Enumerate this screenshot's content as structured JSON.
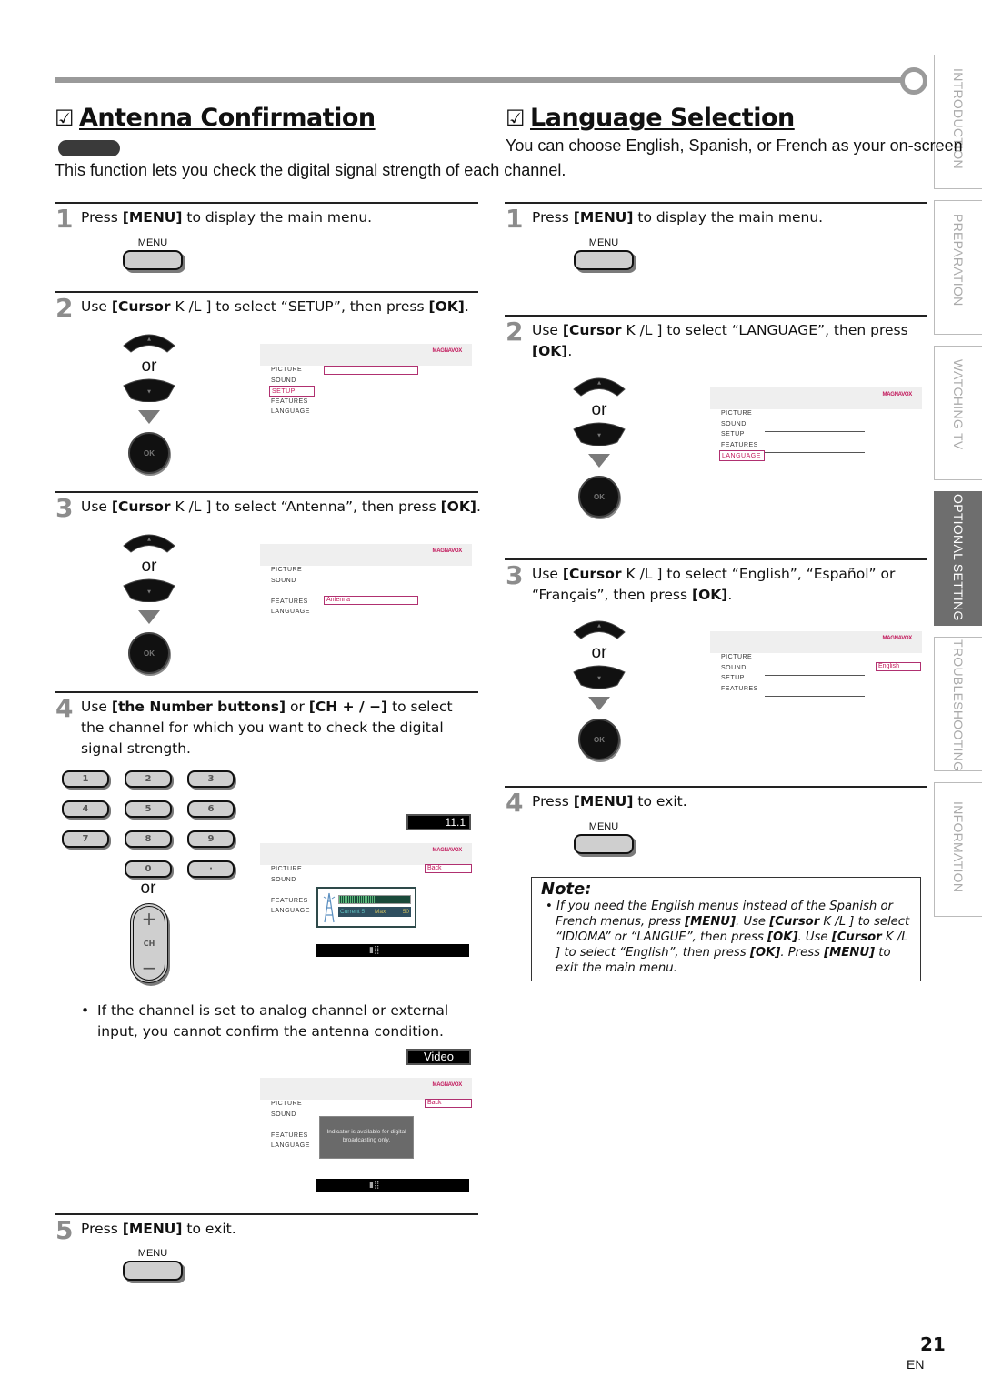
{
  "side_tabs": [
    {
      "label": "INTRODUCTION",
      "active": false
    },
    {
      "label": "PREPARATION",
      "active": false
    },
    {
      "label": "WATCHING  TV",
      "active": false
    },
    {
      "label": "OPTIONAL  SETTING",
      "active": true
    },
    {
      "label": "TROUBLESHOOTING",
      "active": false
    },
    {
      "label": "INFORMATION",
      "active": false
    }
  ],
  "antenna": {
    "title_box": "☑",
    "title": "Antenna Confirmation",
    "intro": "This function lets you check the digital signal strength of each channel.",
    "steps": [
      {
        "num": "1",
        "pre": "Press ",
        "bold": "[MENU]",
        "post": " to display the main menu."
      },
      {
        "num": "2",
        "pre": "Use ",
        "bold": "[Cursor",
        "mid": " K /L ] to select “SETUP”, then press ",
        "bold2": "[OK]",
        "post": "."
      },
      {
        "num": "3",
        "pre": "Use ",
        "bold": "[Cursor",
        "mid": " K /L ] to select “Antenna”, then press ",
        "bold2": "[OK]",
        "post": "."
      },
      {
        "num": "4",
        "pre": "Use ",
        "bold": "[the Number buttons]",
        "mid": " or ",
        "bold2": "[CH + / −]",
        "post": " to select the channel for which you want to check the digital signal strength."
      },
      {
        "num": "5",
        "pre": "Press ",
        "bold": "[MENU]",
        "post": " to exit."
      }
    ],
    "bullet": "If the channel is set to analog channel or external input, you cannot confirm the antenna condition.",
    "number_buttons": [
      "1",
      "2",
      "3",
      "4",
      "5",
      "6",
      "7",
      "8",
      "9",
      "0",
      "·"
    ],
    "ch_rocker": {
      "plus": "+",
      "label": "CH",
      "minus": "−"
    },
    "channel_display": "11.1",
    "signal": {
      "current_label": "Current",
      "current": "5",
      "max_label": "Max",
      "max": "50",
      "level_fraction": 0.5
    },
    "video_display": "Video",
    "back_label": "Back",
    "indicator_message": "Indicator is available for digital broadcasting only."
  },
  "language": {
    "title_box": "☑",
    "title": "Language Selection",
    "intro": "You can choose English, Spanish, or French as your on-screen",
    "steps": [
      {
        "num": "1",
        "pre": "Press ",
        "bold": "[MENU]",
        "post": " to display the main menu."
      },
      {
        "num": "2",
        "pre": "Use ",
        "bold": "[Cursor",
        "mid": " K /L ] to select “LANGUAGE”, then press ",
        "bold2": "[OK]",
        "post": "."
      },
      {
        "num": "3",
        "pre": "Use ",
        "bold": "[Cursor",
        "mid": " K /L ] to select “English”, “Español” or “Français”, then press ",
        "bold2": "[OK]",
        "post": "."
      },
      {
        "num": "4",
        "pre": "Press ",
        "bold": "[MENU]",
        "post": " to exit."
      }
    ],
    "selected_language": "English",
    "note": {
      "title": "Note:",
      "bullet": "•",
      "parts": [
        {
          "t": "If you need the English menus instead of the Spanish or French menus, press "
        },
        {
          "b": "[MENU]"
        },
        {
          "t": ". Use "
        },
        {
          "b": "[Cursor"
        },
        {
          "t": " K /L ] to select “IDIOMA” or “LANGUE”, then press "
        },
        {
          "b": "[OK]"
        },
        {
          "t": ". Use "
        },
        {
          "b": "[Cursor"
        },
        {
          "t": " K /L ] to select “English”, then press "
        },
        {
          "b": "[OK]"
        },
        {
          "t": ". Press "
        },
        {
          "b": "[MENU]"
        },
        {
          "t": " to exit the main menu."
        }
      ]
    }
  },
  "common": {
    "menu_button_label": "MENU",
    "or_text": "or",
    "ok_label": "OK",
    "brand": "MAGNAVOX",
    "tv_menu_items": [
      "PICTURE",
      "SOUND",
      "SETUP",
      "FEATURES",
      "LANGUAGE"
    ],
    "accent_color": "#c2185b"
  },
  "footer": {
    "page_number": "21",
    "language": "EN"
  }
}
